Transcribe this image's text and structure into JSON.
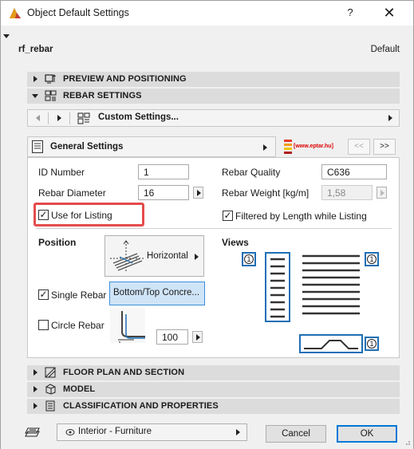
{
  "window": {
    "title": "Object Default Settings",
    "help_label": "?",
    "close_label": "✕"
  },
  "object": {
    "name": "rf_rebar",
    "default_label": "Default"
  },
  "sections": {
    "preview": "PREVIEW AND POSITIONING",
    "rebar": "REBAR SETTINGS",
    "floor_plan": "FLOOR PLAN AND SECTION",
    "model": "MODEL",
    "classification": "CLASSIFICATION AND PROPERTIES"
  },
  "nav": {
    "custom_settings": "Custom Settings..."
  },
  "page": {
    "current": "General Settings",
    "brand": "[www.eptar.hu]",
    "prev_label": "<<",
    "next_label": ">>"
  },
  "general": {
    "id_label": "ID Number",
    "id_value": "1",
    "diameter_label": "Rebar Diameter",
    "diameter_value": "16",
    "quality_label": "Rebar Quality",
    "quality_value": "C636",
    "weight_label": "Rebar Weight [kg/m]",
    "weight_value": "1,58",
    "use_listing_label": "Use for Listing",
    "use_listing_checked": true,
    "filtered_label": "Filtered by Length while Listing",
    "filtered_checked": true
  },
  "position": {
    "label": "Position",
    "orientation": "Horizontal",
    "single_rebar_label": "Single Rebar",
    "single_rebar_checked": true,
    "placement": "Bottom/Top Concre...",
    "circle_rebar_label": "Circle Rebar",
    "circle_rebar_checked": false,
    "circle_value": "100"
  },
  "views": {
    "label": "Views",
    "badge_1": "1",
    "badge_2": "1",
    "badge_3": "1"
  },
  "footer": {
    "layer": "Interior - Furniture",
    "cancel_label": "Cancel",
    "ok_label": "OK"
  },
  "colors": {
    "highlight": "#e54b4b",
    "selection_bg": "#cfe4f7",
    "selection_border": "#3c8fdc",
    "badge_border": "#1f6fb5"
  }
}
